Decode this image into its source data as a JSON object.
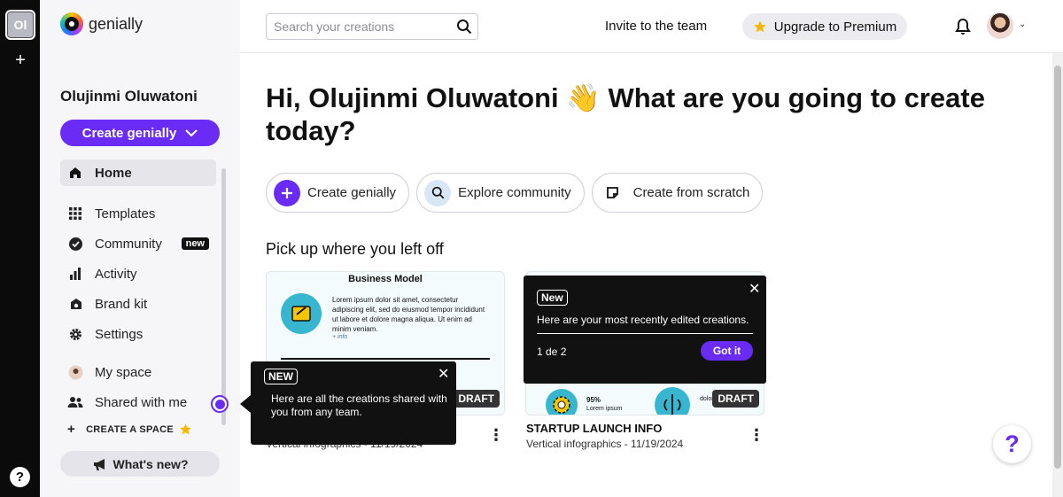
{
  "rail": {
    "workspace_initials": "Ol"
  },
  "brand": {
    "name": "genially"
  },
  "sidebar": {
    "user_name": "Olujinmi Oluwatoni",
    "create_label": "Create genially",
    "items": [
      {
        "label": "Home",
        "icon": "home-icon"
      },
      {
        "label": "Templates",
        "icon": "grid-icon"
      },
      {
        "label": "Community",
        "icon": "verified-icon",
        "badge": "new"
      },
      {
        "label": "Activity",
        "icon": "bar-chart-icon"
      },
      {
        "label": "Brand kit",
        "icon": "brand-kit-icon"
      },
      {
        "label": "Settings",
        "icon": "gear-icon"
      }
    ],
    "spaces": [
      {
        "label": "My space",
        "icon": "avatar-icon"
      },
      {
        "label": "Shared with me",
        "icon": "people-icon"
      }
    ],
    "create_space": "CREATE A SPACE",
    "whats_new": "What's new?"
  },
  "topbar": {
    "search_placeholder": "Search your creations",
    "invite": "Invite to the team",
    "upgrade": "Upgrade to Premium"
  },
  "main": {
    "greeting": "Hi, Olujinmi Oluwatoni 👋 What are you going to create today?",
    "actions": [
      {
        "label": "Create genially",
        "icon": "plus-icon"
      },
      {
        "label": "Explore community",
        "icon": "search-icon"
      },
      {
        "label": "Create from scratch",
        "icon": "page-icon"
      }
    ],
    "section_title": "Pick up where you left off",
    "cards": [
      {
        "thumb_title": "Business Model",
        "thumb_text": "Lorem ipsum dolor sit amet, consectetur adipiscing elit, sed do eiusmod tempor incididunt ut labore et dolore magna aliqua. Ut enim ad minim veniam.",
        "thumb_link": "+ info",
        "badge": "DRAFT",
        "title": "",
        "meta": "Vertical infographics - 11/19/2024"
      },
      {
        "thumb_stat": "95%",
        "thumb_text": "Lorem ipsum",
        "thumb_text2": "dolor",
        "badge": "DRAFT",
        "title": "STARTUP LAUNCH INFO",
        "meta": "Vertical infographics - 11/19/2024"
      }
    ]
  },
  "tooltips": {
    "recent": {
      "tag": "New",
      "text": "Here are your most recently edited creations.",
      "step": "1 de 2",
      "button": "Got it"
    },
    "shared": {
      "tag": "NEW",
      "text": "Here are all the creations shared with you from any team."
    }
  },
  "colors": {
    "accent": "#6a2cf5",
    "rail": "#0b0b0b",
    "sidebar": "#f6f6f8"
  }
}
